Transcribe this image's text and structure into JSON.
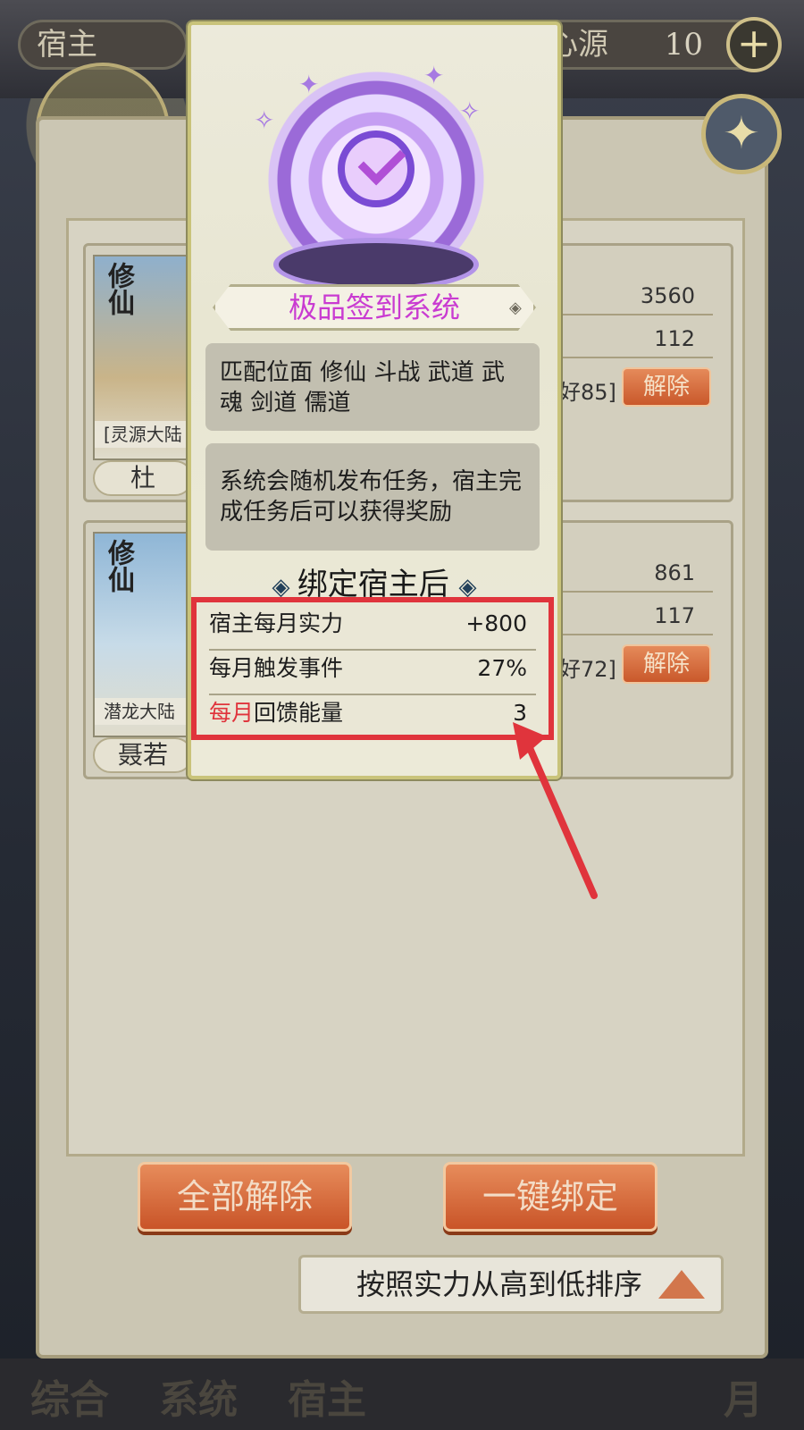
{
  "header": {
    "left_label": "宿主",
    "right_label": "心源",
    "right_count": "10",
    "plus_symbol": "+"
  },
  "hosts": [
    {
      "category": "修仙",
      "world": "[灵源大陆",
      "name": "杜",
      "stat_1": "3560",
      "stat_2": "112",
      "favor": "好85]",
      "release_label": "解除"
    },
    {
      "category": "修仙",
      "world": "潜龙大陆",
      "name": "聂若",
      "stat_1": "861",
      "stat_2": "117",
      "favor": "好72]",
      "release_label": "解除"
    }
  ],
  "actions": {
    "release_all": "全部解除",
    "bind_all": "一键绑定",
    "sort_label": "按照实力从高到低排序"
  },
  "bottom_nav": [
    "综合",
    "系统",
    "宿主",
    "月"
  ],
  "modal": {
    "title": "极品签到系统",
    "match_text": "匹配位面 修仙 斗战 武道 武魂 剑道 儒道",
    "desc_text": "系统会随机发布任务，宿主完成任务后可以获得奖励",
    "after_bind_title": "绑定宿主后",
    "bonuses": [
      {
        "label": "宿主每月实力",
        "value": "+800"
      },
      {
        "label": "每月触发事件",
        "value": "27%"
      },
      {
        "label_highlight": "每月",
        "label_rest": "回馈能量",
        "value": "3"
      }
    ]
  },
  "colors": {
    "title_magenta": "#c93bd1",
    "highlight_red": "#e0343c",
    "button_orange": "#d2683c"
  }
}
